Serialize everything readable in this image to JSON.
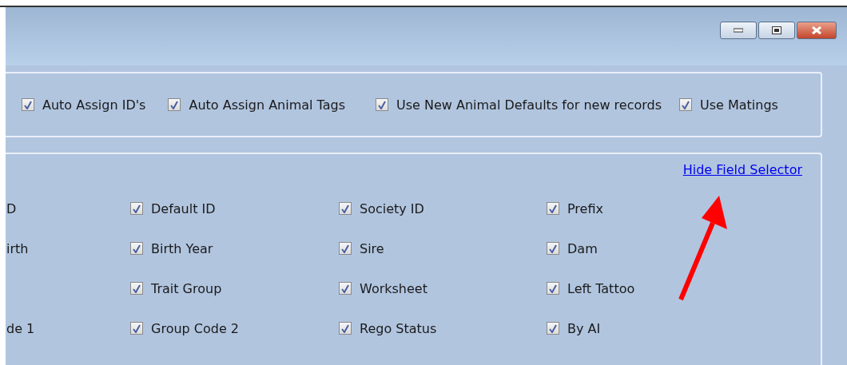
{
  "window_controls": [
    {
      "kind": "minimize"
    },
    {
      "kind": "maximize"
    },
    {
      "kind": "close"
    }
  ],
  "options": [
    {
      "label": "Auto Assign ID's",
      "checked": true
    },
    {
      "label": "Auto Assign Animal Tags",
      "checked": true
    },
    {
      "label": "Use New Animal Defaults for new records",
      "checked": true
    },
    {
      "label": "Use Matings",
      "checked": true
    }
  ],
  "field_selector": {
    "link": "Hide Field Selector",
    "rows": [
      {
        "cut_label": "D",
        "fields": [
          {
            "label": "Default ID",
            "checked": true
          },
          {
            "label": "Society ID",
            "checked": true
          },
          {
            "label": "Prefix",
            "checked": true
          }
        ]
      },
      {
        "cut_label": "irth",
        "fields": [
          {
            "label": "Birth Year",
            "checked": true
          },
          {
            "label": "Sire",
            "checked": true
          },
          {
            "label": "Dam",
            "checked": true
          }
        ]
      },
      {
        "fields": [
          {
            "label": "Trait Group",
            "checked": true
          },
          {
            "label": "Worksheet",
            "checked": true
          },
          {
            "label": "Left Tattoo",
            "checked": true
          }
        ]
      },
      {
        "cut_label": "de 1",
        "fields": [
          {
            "label": "Group Code 2",
            "checked": true
          },
          {
            "label": "Rego Status",
            "checked": true
          },
          {
            "label": "By AI",
            "checked": true
          }
        ]
      }
    ]
  }
}
